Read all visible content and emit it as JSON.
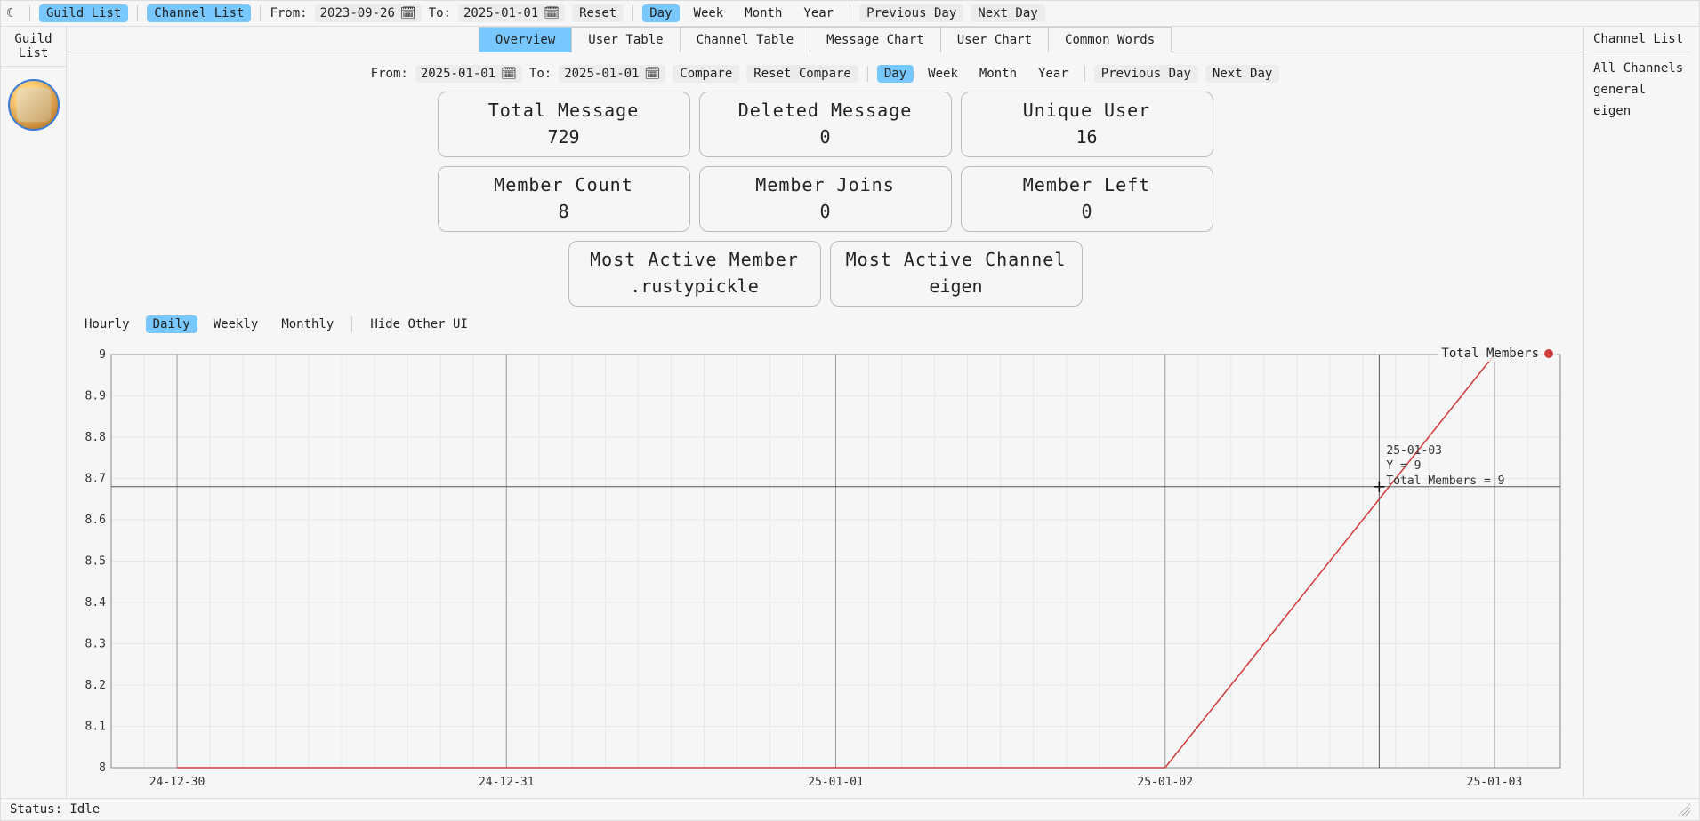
{
  "toolbar": {
    "theme_icon": "☾",
    "guild_list": "Guild List",
    "channel_list": "Channel List",
    "from_label": "From:",
    "from_value": "2023-09-26",
    "to_label": "To:",
    "to_value": "2025-01-01",
    "reset": "Reset",
    "ranges": {
      "day": "Day",
      "week": "Week",
      "month": "Month",
      "year": "Year"
    },
    "prev_day": "Previous Day",
    "next_day": "Next Day",
    "calendar_icon": "🗓"
  },
  "left_panel": {
    "title": "Guild\nList"
  },
  "right_panel": {
    "title": "Channel List",
    "items": [
      "All Channels",
      "general",
      "eigen"
    ]
  },
  "tabs": [
    "Overview",
    "User Table",
    "Channel Table",
    "Message Chart",
    "User Chart",
    "Common Words"
  ],
  "compare": {
    "from_label": "From:",
    "from_value": "2025-01-01",
    "to_label": "To:",
    "to_value": "2025-01-01",
    "compare": "Compare",
    "reset": "Reset Compare",
    "ranges": {
      "day": "Day",
      "week": "Week",
      "month": "Month",
      "year": "Year"
    },
    "prev_day": "Previous Day",
    "next_day": "Next Day"
  },
  "stats": {
    "total_message": {
      "label": "Total Message",
      "value": "729"
    },
    "deleted_message": {
      "label": "Deleted Message",
      "value": "0"
    },
    "unique_user": {
      "label": "Unique User",
      "value": "16"
    },
    "member_count": {
      "label": "Member Count",
      "value": "8"
    },
    "member_joins": {
      "label": "Member Joins",
      "value": "0"
    },
    "member_left": {
      "label": "Member Left",
      "value": "0"
    },
    "most_active_member": {
      "label": "Most Active Member",
      "value": ".rustypickle"
    },
    "most_active_channel": {
      "label": "Most Active Channel",
      "value": "eigen"
    }
  },
  "granularity": {
    "hourly": "Hourly",
    "daily": "Daily",
    "weekly": "Weekly",
    "monthly": "Monthly",
    "hide_ui": "Hide Other UI"
  },
  "chart": {
    "legend": "Total Members",
    "hover": {
      "date": "25-01-03",
      "y_line": "Y = 9",
      "series_line": "Total Members = 9"
    }
  },
  "chart_data": {
    "type": "line",
    "xlabel": "",
    "ylabel": "",
    "ylim": [
      8,
      9
    ],
    "y_ticks": [
      8,
      8.1,
      8.2,
      8.3,
      8.4,
      8.5,
      8.6,
      8.7,
      8.8,
      8.9,
      9
    ],
    "x_ticks": [
      "24-12-30",
      "24-12-31",
      "25-01-01",
      "25-01-02",
      "25-01-03"
    ],
    "cursor": {
      "x": "25-01-02.65",
      "y": 8.68
    },
    "series": [
      {
        "name": "Total Members",
        "color": "#d23b3b",
        "points": [
          {
            "x": "24-12-30",
            "y": 8
          },
          {
            "x": "24-12-31",
            "y": 8
          },
          {
            "x": "25-01-01",
            "y": 8
          },
          {
            "x": "25-01-02",
            "y": 8
          },
          {
            "x": "25-01-03",
            "y": 9
          }
        ]
      }
    ]
  },
  "status": {
    "text": "Status: Idle"
  }
}
